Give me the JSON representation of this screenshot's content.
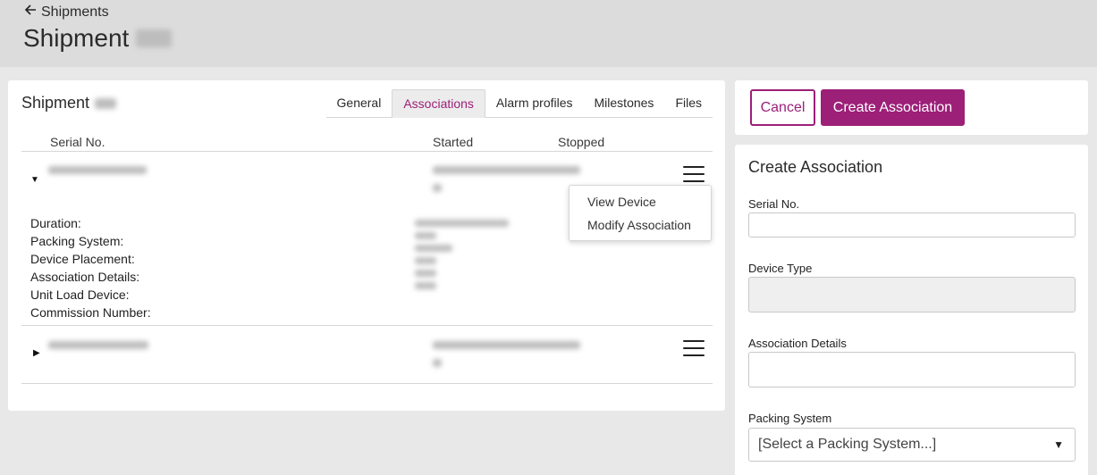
{
  "header": {
    "back_label": "Shipments",
    "title": "Shipment"
  },
  "left_card": {
    "title": "Shipment",
    "tabs": [
      {
        "label": "General"
      },
      {
        "label": "Associations"
      },
      {
        "label": "Alarm profiles"
      },
      {
        "label": "Milestones"
      },
      {
        "label": "Files"
      }
    ],
    "active_tab": "Associations",
    "columns": {
      "serial": "Serial No.",
      "started": "Started",
      "stopped": "Stopped"
    },
    "detail_labels": [
      "Duration:",
      "Packing System:",
      "Device Placement:",
      "Association Details:",
      "Unit Load Device:",
      "Commission Number:"
    ],
    "row_menu": {
      "items": [
        "View Device",
        "Modify Association"
      ]
    }
  },
  "actions": {
    "cancel_label": "Cancel",
    "create_label": "Create Association"
  },
  "form": {
    "title": "Create Association",
    "serial_label": "Serial No.",
    "device_type_label": "Device Type",
    "association_details_label": "Association Details",
    "packing_system_label": "Packing System",
    "packing_system_value": "[Select a Packing System...]"
  },
  "icons": {
    "back": "arrow-left-icon",
    "expand": "caret-down-icon",
    "collapse": "caret-right-icon",
    "row_menu": "hamburger-menu-icon",
    "select": "triangle-down-icon"
  },
  "colors": {
    "accent": "#9c1f78",
    "header_bg": "#dcdcdc",
    "page_bg": "#e8e8e8"
  }
}
